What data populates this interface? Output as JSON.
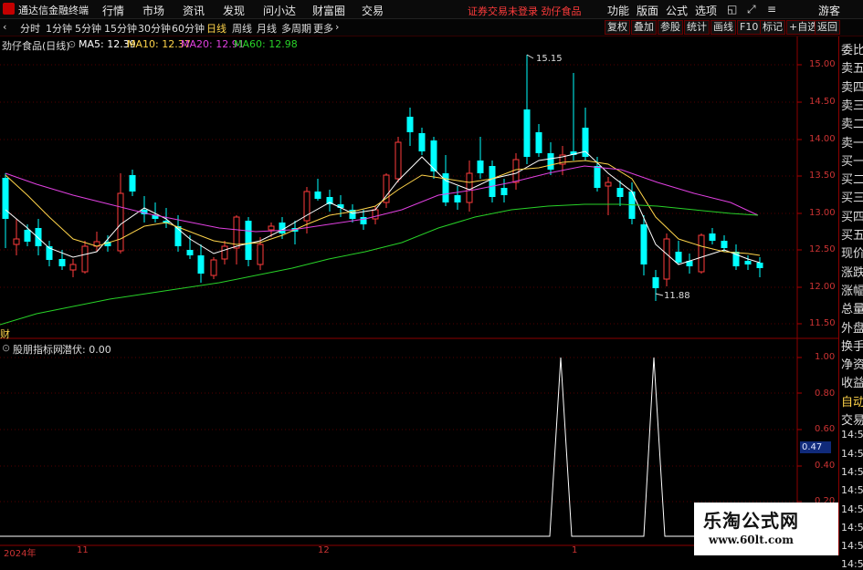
{
  "titlebar": {
    "app_name": "通达信金融终端",
    "menus": [
      "行情",
      "市场",
      "资讯",
      "发现",
      "问小达",
      "财富圈",
      "交易"
    ],
    "notice": "证券交易未登录  劲仔食品",
    "buttons": [
      "功能",
      "版面",
      "公式",
      "选项"
    ],
    "user": "游客"
  },
  "toolbar": {
    "periods": [
      "分时",
      "1分钟",
      "5分钟",
      "15分钟",
      "30分钟",
      "60分钟",
      "日线",
      "周线",
      "月线",
      "多周期",
      "更多"
    ],
    "active_period": "日线",
    "right_buttons": [
      "复权",
      "叠加",
      "参股",
      "统计",
      "画线",
      "F10",
      "标记",
      "+自选",
      "返回"
    ]
  },
  "main_chart": {
    "title": "劲仔食品(日线)",
    "ma": [
      {
        "label": "MA5: 12.39",
        "color": "#ffffff"
      },
      {
        "label": "MA10: 12.37",
        "color": "#ffd44a"
      },
      {
        "label": "MA20: 12.91",
        "color": "#e040e0"
      },
      {
        "label": "MA60: 12.98",
        "color": "#28d228"
      }
    ],
    "y_ticks": [
      "15.00",
      "14.50",
      "14.00",
      "13.50",
      "13.00",
      "12.50",
      "12.00",
      "11.50"
    ],
    "max_label": "15.15",
    "min_label": "11.88",
    "corner_label": "财"
  },
  "indicator": {
    "title": "股朋指标网",
    "param": "潜伏: 0.00",
    "y_ticks": [
      "1.00",
      "0.80",
      "0.60",
      "0.40",
      "0.20"
    ],
    "current_value": "0.47"
  },
  "x_axis": [
    "2024年",
    "11",
    "12",
    "1"
  ],
  "sidebar": {
    "items": [
      "委比",
      "卖五",
      "卖四",
      "卖三",
      "卖二",
      "卖一",
      "买一",
      "买二",
      "买三",
      "买四",
      "买五",
      "现价",
      "涨跌",
      "涨幅",
      "总量",
      "外盘",
      "换手",
      "净资",
      "收益",
      "自动",
      "交易",
      "14:56",
      "14:56",
      "14:56",
      "14:56",
      "14:56",
      "14:56",
      "14:56",
      "14:56"
    ]
  },
  "watermark": {
    "title": "乐淘公式网",
    "url": "www.60lt.com"
  },
  "colors": {
    "up": "#ff3b3b",
    "down": "#00ffff",
    "grid": "#550000",
    "accent": "#ffd44a"
  }
}
